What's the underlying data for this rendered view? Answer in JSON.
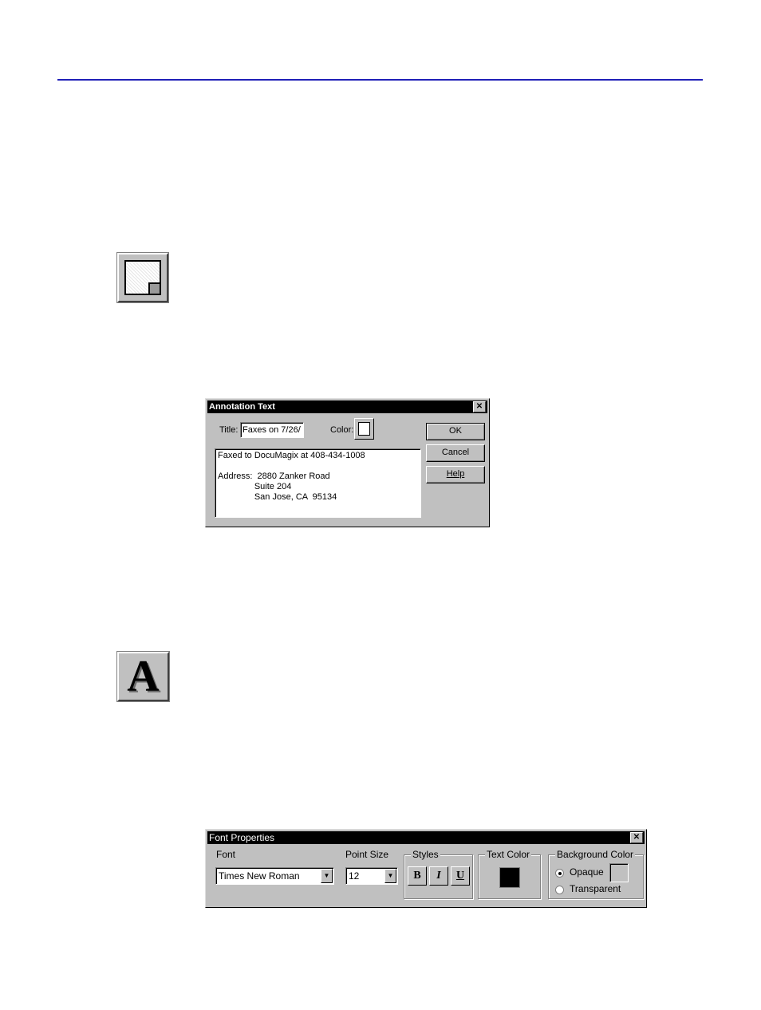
{
  "annotation_dialog": {
    "title": "Annotation Text",
    "close_glyph": "✕",
    "title_label": "Title:",
    "title_value": "Faxes on 7/26/",
    "color_label": "Color:",
    "body_lines": [
      "Faxed to DocuMagix at 408-434-1008",
      "",
      "Address:  2880 Zanker Road",
      "               Suite 204",
      "               San Jose, CA  95134"
    ],
    "ok_label": "OK",
    "cancel_label": "Cancel",
    "help_label": "Help"
  },
  "font_dialog": {
    "title": "Font Properties",
    "close_glyph": "✕",
    "font_label": "Font",
    "font_value": "Times New Roman",
    "point_size_label": "Point Size",
    "point_size_value": "12",
    "styles_label": "Styles",
    "bold_label": "B",
    "italic_label": "I",
    "underline_label": "U",
    "text_color_label": "Text Color",
    "background_color_label": "Background Color",
    "opaque_label": "Opaque",
    "transparent_label": "Transparent",
    "background_mode": "Opaque"
  },
  "icons": {
    "note_tool": "sticky-note-icon",
    "text_tool": "text-A-icon",
    "text_tool_glyph": "A"
  },
  "colors": {
    "rule": "#2020b8",
    "text_color": "#000000"
  }
}
